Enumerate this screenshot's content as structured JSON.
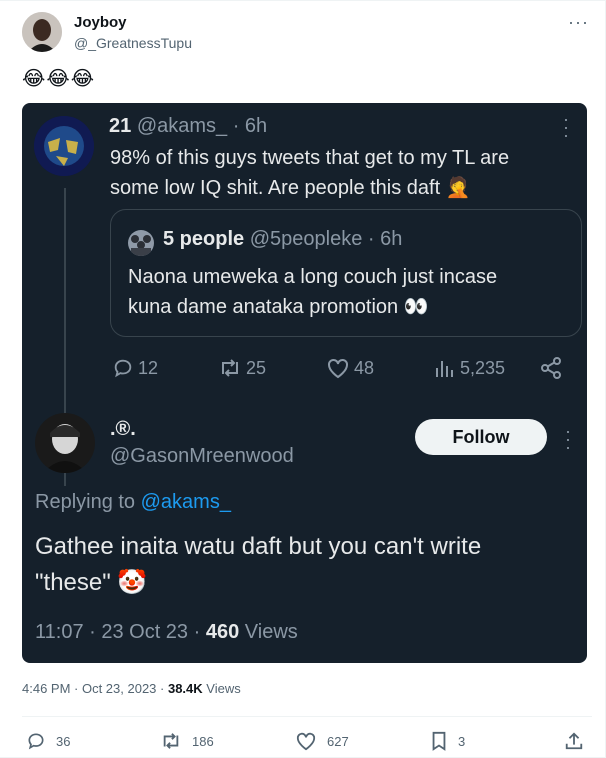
{
  "outer": {
    "author_name": "Joyboy",
    "author_handle": "@_GreatnessTupu",
    "more_label": "···",
    "body_emoji": "😂😂😂",
    "timestamp": "4:46 PM · Oct 23, 2023 · ",
    "views_count": "38.4K",
    "views_label": " Views",
    "actions": {
      "replies": "36",
      "reposts": "186",
      "likes": "627",
      "bookmarks": "3"
    }
  },
  "embedded": {
    "tweet1": {
      "name": "21",
      "handle_time": "@akams_ · 6h",
      "body_line1": "98% of this guys tweets that get to my TL are",
      "body_line2": "some low IQ shit. Are people this daft 🤦",
      "quote": {
        "name": "5 people",
        "handle_time": "@5peopleke · 6h",
        "line1": "Naona umeweka a long couch just incase",
        "line2": "kuna dame anataka promotion 👀"
      },
      "stats": {
        "replies": "12",
        "reposts": "25",
        "likes": "48",
        "views": "5,235"
      }
    },
    "reply": {
      "name": ".®.",
      "handle": "@GasonMreenwood",
      "follow_label": "Follow",
      "replying_prefix": "Replying to ",
      "replying_handle": "@akams_",
      "body_line1": "Gathee inaita watu daft but you can't write",
      "body_line2": "\"these\" 🤡",
      "meta_time": "11:07 · 23 Oct 23 · ",
      "meta_views_count": "460",
      "meta_views_label": " Views"
    }
  },
  "colors": {
    "dark_bg": "#15202b",
    "link_blue": "#1d9bf0",
    "dark_text": "#e7e9ea",
    "dark_grey": "#8b98a5"
  }
}
